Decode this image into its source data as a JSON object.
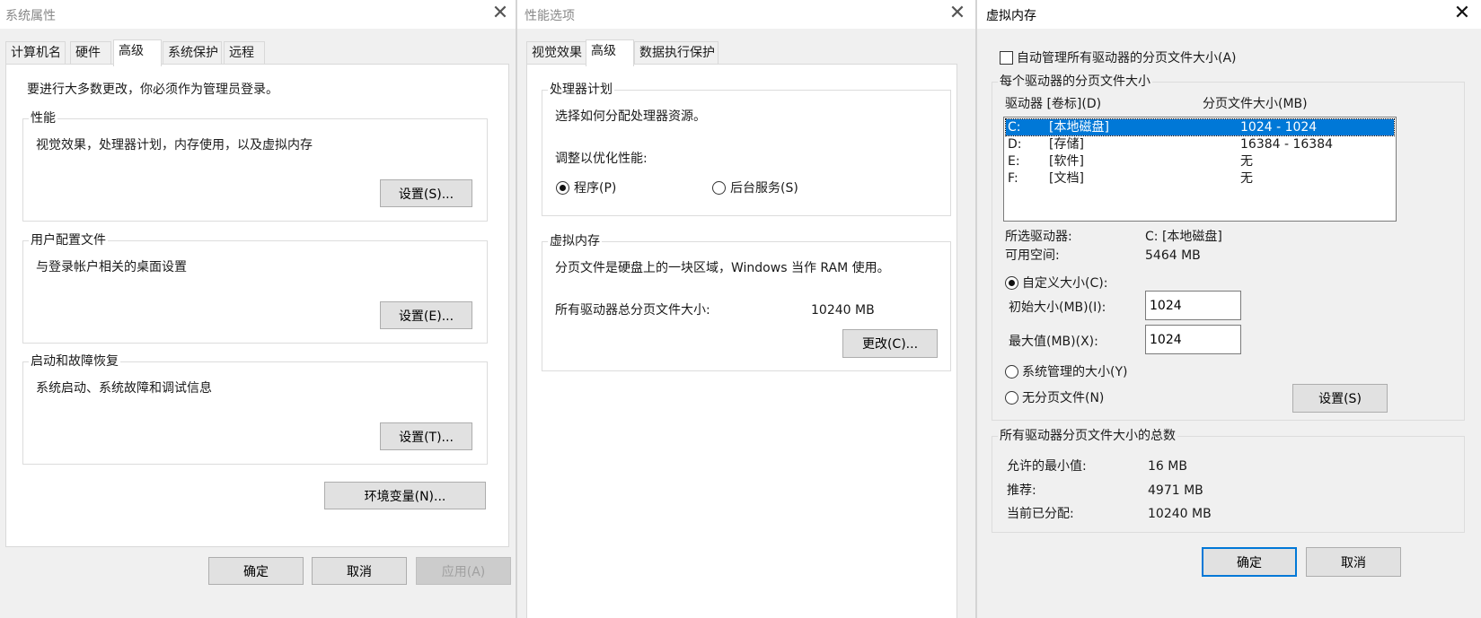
{
  "sys": {
    "title": "系统属性",
    "tabs": [
      "计算机名",
      "硬件",
      "高级",
      "系统保护",
      "远程"
    ],
    "admin_note": "要进行大多数更改，你必须作为管理员登录。",
    "perf": {
      "label": "性能",
      "desc": "视觉效果，处理器计划，内存使用，以及虚拟内存",
      "btn": "设置(S)..."
    },
    "profile": {
      "label": "用户配置文件",
      "desc": "与登录帐户相关的桌面设置",
      "btn": "设置(E)..."
    },
    "startup": {
      "label": "启动和故障恢复",
      "desc": "系统启动、系统故障和调试信息",
      "btn": "设置(T)..."
    },
    "env_btn": "环境变量(N)...",
    "ok": "确定",
    "cancel": "取消",
    "apply": "应用(A)"
  },
  "perf_opts": {
    "title": "性能选项",
    "tabs": [
      "视觉效果",
      "高级",
      "数据执行保护"
    ],
    "sched": {
      "label": "处理器计划",
      "desc": "选择如何分配处理器资源。",
      "adjust": "调整以优化性能:",
      "opt_programs": "程序(P)",
      "opt_services": "后台服务(S)"
    },
    "vm": {
      "label": "虚拟内存",
      "desc": "分页文件是硬盘上的一块区域，Windows 当作 RAM 使用。",
      "total_label": "所有驱动器总分页文件大小:",
      "total_value": "10240 MB",
      "btn": "更改(C)..."
    }
  },
  "vmem": {
    "title": "虚拟内存",
    "auto_manage": "自动管理所有驱动器的分页文件大小(A)",
    "per_drive_label": "每个驱动器的分页文件大小",
    "col_drive": "驱动器 [卷标](D)",
    "col_size": "分页文件大小(MB)",
    "drives": [
      {
        "letter": "C:",
        "label": "[本地磁盘]",
        "size": "1024 - 1024"
      },
      {
        "letter": "D:",
        "label": "[存储]",
        "size": "16384 - 16384"
      },
      {
        "letter": "E:",
        "label": "[软件]",
        "size": "无"
      },
      {
        "letter": "F:",
        "label": "[文档]",
        "size": "无"
      }
    ],
    "selected_label": "所选驱动器:",
    "selected_value": "C:  [本地磁盘]",
    "free_label": "可用空间:",
    "free_value": "5464 MB",
    "custom": "自定义大小(C):",
    "initial_label": "初始大小(MB)(I):",
    "initial_value": "1024",
    "max_label": "最大值(MB)(X):",
    "max_value": "1024",
    "system_managed": "系统管理的大小(Y)",
    "no_paging": "无分页文件(N)",
    "set_btn": "设置(S)",
    "totals_label": "所有驱动器分页文件大小的总数",
    "min_label": "允许的最小值:",
    "min_value": "16 MB",
    "rec_label": "推荐:",
    "rec_value": "4971 MB",
    "cur_label": "当前已分配:",
    "cur_value": "10240 MB",
    "ok": "确定",
    "cancel": "取消"
  }
}
